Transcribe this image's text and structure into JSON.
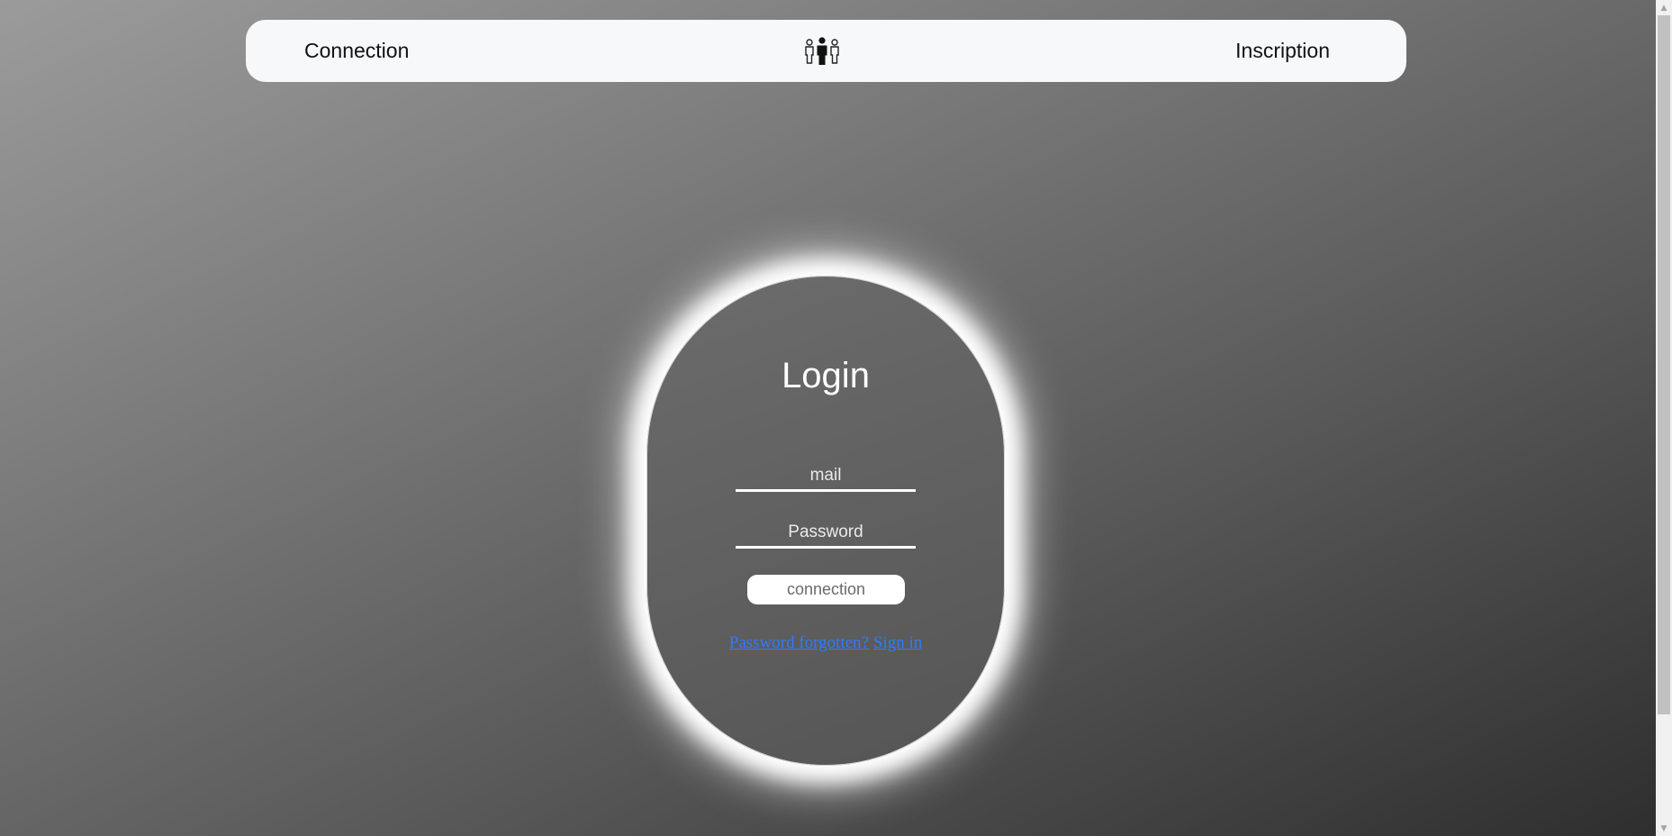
{
  "navbar": {
    "left_link": "Connection",
    "right_link": "Inscription",
    "logo_icon": "people-group-icon"
  },
  "login": {
    "title": "Login",
    "mail_placeholder": "mail",
    "password_placeholder": "Password",
    "button_label": "connection",
    "forgot_link": "Password forgotten?",
    "signin_link": "Sign in"
  },
  "colors": {
    "link": "#2f7bff",
    "glow": "#ffffff",
    "navbar_bg": "#f7f8fa"
  },
  "scrollbar": {
    "up_icon": "scroll-up-arrow-icon",
    "down_icon": "scroll-down-arrow-icon"
  }
}
